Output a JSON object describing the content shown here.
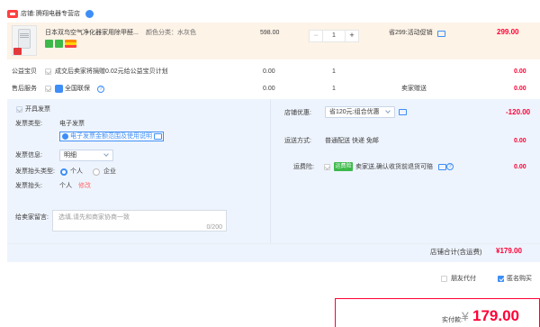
{
  "shop": {
    "label": "店铺:",
    "name": "腾翔电器专营店"
  },
  "item": {
    "title": "日本双鸟空气净化器家用除甲醛...",
    "attr": "颜色分类：水灰色",
    "price": "598.00",
    "quantity": "1",
    "promo": "省299:活动促销",
    "subtotal": "299.00"
  },
  "public_welfare": {
    "label": "公益宝贝",
    "text": "成交后卖家将捐赠0.02元给公益宝贝计划",
    "price": "0.00",
    "qty": "1",
    "amount": "0.00"
  },
  "after_sales": {
    "label": "售后服务",
    "text": "全国联保",
    "price": "0.00",
    "qty": "1",
    "note": "卖家赠送",
    "amount": "0.00"
  },
  "invoice": {
    "toggle_label": "开具发票",
    "type_label": "发票类型:",
    "type_value": "电子发票",
    "scope_link": "电子发票金额范围及使用说明",
    "info_label": "发票信息:",
    "info_value": "明细",
    "header_type_label": "发票抬头类型:",
    "header_type_options": [
      "个人",
      "企业"
    ],
    "header_label": "发票抬头:",
    "header_value": "个人",
    "header_edit": "修改"
  },
  "message": {
    "label": "给卖家留言:",
    "placeholder": "选填,请先和商家协商一致",
    "counter": "0/200"
  },
  "shop_discount": {
    "label": "店铺优惠:",
    "value": "省120元:组合优惠",
    "amount": "-120.00"
  },
  "delivery": {
    "label": "运送方式:",
    "value": "普通配送 快递 免邮",
    "amount": "0.00"
  },
  "shipping_insurance": {
    "label": "运费险:",
    "badge": "运费险",
    "text": "卖家送,确认收货前退货可赔",
    "amount": "0.00"
  },
  "shop_total": {
    "label": "店铺合计(含运费)",
    "amount": "¥179.00"
  },
  "options": {
    "anonymous_friend": "朋友代付",
    "anonymous_buy": "匿名购买"
  },
  "payment": {
    "label": "实付款:",
    "currency": "¥",
    "amount": "179.00"
  },
  "colors": {
    "accent_red": "#ff0036",
    "blue": "#3e8ef7",
    "item_bg": "#fdf3e7",
    "panel_bg": "#eef4fd"
  },
  "icons": [
    "shop-icon",
    "wangwang-icon",
    "product-thumbnail",
    "chat-icon",
    "info-icon",
    "checkbox",
    "radio",
    "chevron-down-icon"
  ]
}
